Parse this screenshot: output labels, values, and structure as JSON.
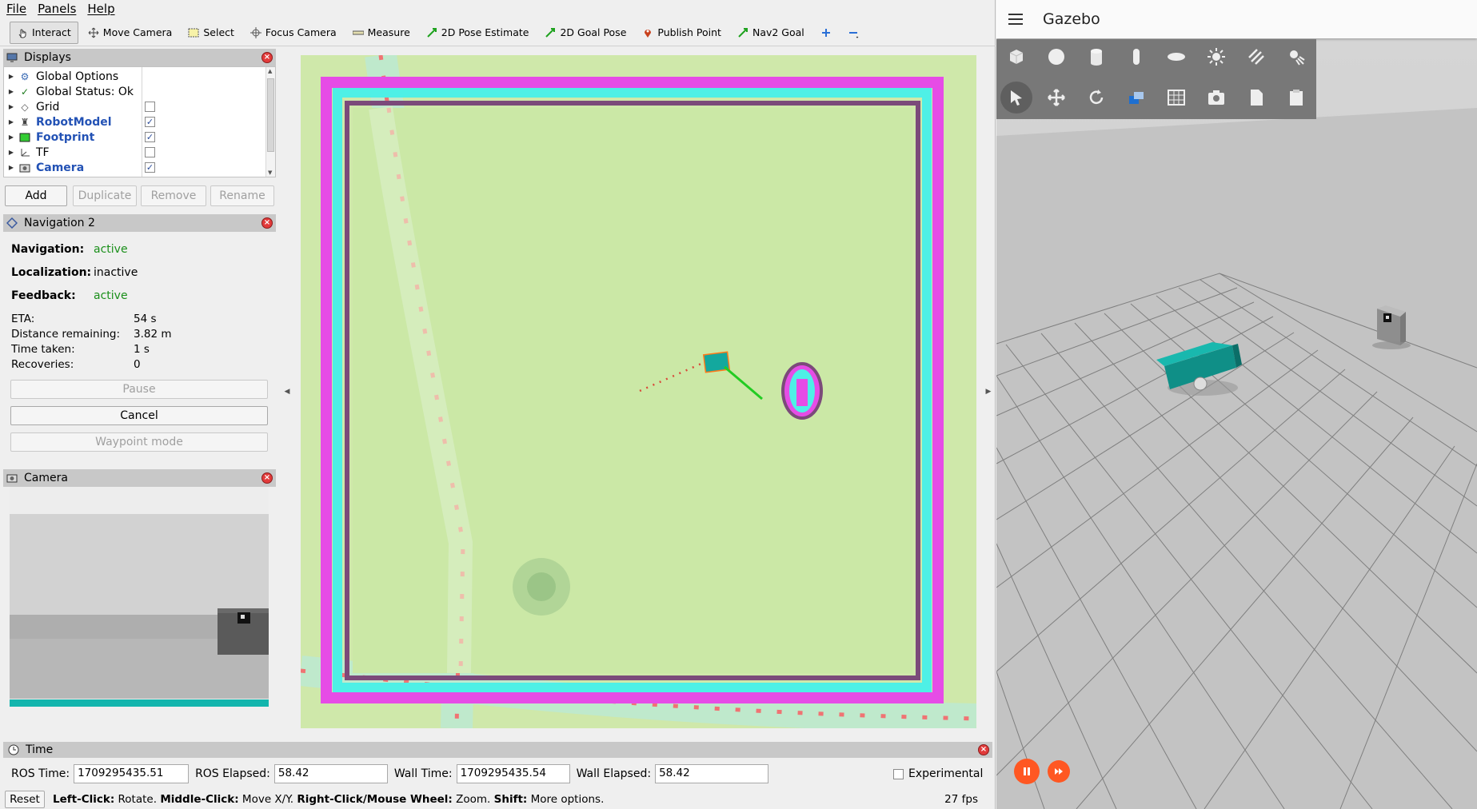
{
  "rviz": {
    "menu": [
      "File",
      "Panels",
      "Help"
    ],
    "tools": [
      {
        "label": "Interact",
        "icon": "hand-pointer-icon"
      },
      {
        "label": "Move Camera",
        "icon": "move-arrows-icon"
      },
      {
        "label": "Select",
        "icon": "select-box-icon"
      },
      {
        "label": "Focus Camera",
        "icon": "crosshair-icon"
      },
      {
        "label": "Measure",
        "icon": "ruler-icon"
      },
      {
        "label": "2D Pose Estimate",
        "icon": "green-arrow-icon"
      },
      {
        "label": "2D Goal Pose",
        "icon": "green-arrow-icon"
      },
      {
        "label": "Publish Point",
        "icon": "map-pin-icon"
      },
      {
        "label": "Nav2 Goal",
        "icon": "green-arrow-icon"
      }
    ],
    "displays": {
      "title": "Displays",
      "items": [
        {
          "label": "Global Options",
          "icon": "gear-icon",
          "checkbox": null,
          "checked": false,
          "highlight": false
        },
        {
          "label": "Global Status: Ok",
          "icon": "checkmark-icon",
          "checkbox": null,
          "checked": false,
          "highlight": false
        },
        {
          "label": "Grid",
          "icon": "grid-icon",
          "checkbox": true,
          "checked": false,
          "highlight": false
        },
        {
          "label": "RobotModel",
          "icon": "robot-icon",
          "checkbox": true,
          "checked": true,
          "highlight": true
        },
        {
          "label": "Footprint",
          "icon": "polygon-icon",
          "checkbox": true,
          "checked": true,
          "highlight": true
        },
        {
          "label": "TF",
          "icon": "axes-icon",
          "checkbox": true,
          "checked": false,
          "highlight": false
        },
        {
          "label": "Camera",
          "icon": "camera-icon",
          "checkbox": true,
          "checked": true,
          "highlight": true
        }
      ],
      "buttons": {
        "add": "Add",
        "duplicate": "Duplicate",
        "remove": "Remove",
        "rename": "Rename"
      }
    },
    "navigation": {
      "title": "Navigation 2",
      "navigation_label": "Navigation:",
      "navigation_value": "active",
      "localization_label": "Localization:",
      "localization_value": "inactive",
      "feedback_label": "Feedback:",
      "feedback_value": "active",
      "eta_label": "ETA:",
      "eta_value": "54 s",
      "distance_label": "Distance remaining:",
      "distance_value": "3.82 m",
      "time_label": "Time taken:",
      "time_value": "1 s",
      "recoveries_label": "Recoveries:",
      "recoveries_value": "0",
      "pause": "Pause",
      "cancel": "Cancel",
      "waypoint": "Waypoint mode"
    },
    "camera": {
      "title": "Camera"
    },
    "time": {
      "title": "Time",
      "ros_time_label": "ROS Time:",
      "ros_time": "1709295435.51",
      "ros_elapsed_label": "ROS Elapsed:",
      "ros_elapsed": "58.42",
      "wall_time_label": "Wall Time:",
      "wall_time": "1709295435.54",
      "wall_elapsed_label": "Wall Elapsed:",
      "wall_elapsed": "58.42",
      "experimental": "Experimental"
    },
    "status": {
      "reset": "Reset",
      "k1": "Left-Click:",
      "v1": " Rotate. ",
      "k2": "Middle-Click:",
      "v2": " Move X/Y. ",
      "k3": "Right-Click/Mouse Wheel:",
      "v3": " Zoom. ",
      "k4": "Shift:",
      "v4": " More options.",
      "fps": "27 fps"
    },
    "colors": {
      "costmap_magenta": "#e64ce6",
      "costmap_cyan": "#4ef0e6",
      "map_bg": "#cde8a8",
      "path_green": "#22cc22",
      "robot_teal": "#13a89e"
    }
  },
  "gazebo": {
    "title": "Gazebo",
    "tool_icons_row1": [
      "box-shape-icon",
      "sphere-shape-icon",
      "cylinder-shape-icon",
      "capsule-shape-icon",
      "ellipsoid-shape-icon",
      "sun-light-icon",
      "directional-light-icon",
      "spot-light-icon"
    ],
    "tool_icons_row2": [
      "select-arrow-icon",
      "translate-icon",
      "rotate-icon",
      "transform-icon",
      "grid-snap-icon",
      "screenshot-icon",
      "copy-icon",
      "paste-icon"
    ],
    "accent": "#ff5722"
  }
}
